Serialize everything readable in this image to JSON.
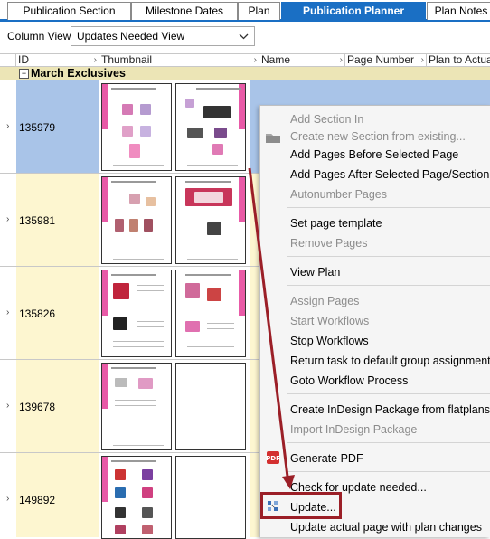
{
  "tabs": [
    {
      "label": "Publication Section",
      "active": false
    },
    {
      "label": "Milestone Dates",
      "active": false
    },
    {
      "label": "Plan",
      "active": false
    },
    {
      "label": "Publication Planner",
      "active": true
    },
    {
      "label": "Plan Notes",
      "active": false
    }
  ],
  "column_view": {
    "label": "Column View:",
    "value": "Updates Needed View"
  },
  "grid": {
    "headers": [
      "ID",
      "Thumbnail",
      "Name",
      "Page Number",
      "Plan to Actual"
    ],
    "group": {
      "toggle": "−",
      "title": "March Exclusives"
    },
    "rows": [
      {
        "id": "135979"
      },
      {
        "id": "135981"
      },
      {
        "id": "135826"
      },
      {
        "id": "139678"
      },
      {
        "id": "149892"
      }
    ]
  },
  "context_menu": {
    "items": [
      {
        "label": "Add Section In",
        "disabled": true
      },
      {
        "label": "Create new Section from existing...",
        "disabled": true,
        "icon": "folder-icon"
      },
      {
        "label": "Add Pages Before Selected Page",
        "disabled": false
      },
      {
        "label": "Add Pages After Selected Page/Section",
        "disabled": false
      },
      {
        "label": "Autonumber Pages",
        "disabled": true
      },
      {
        "label": "Set page template",
        "disabled": false
      },
      {
        "label": "Remove Pages",
        "disabled": true
      },
      {
        "label": "View Plan",
        "disabled": false
      },
      {
        "label": "Assign Pages",
        "disabled": true
      },
      {
        "label": "Start Workflows",
        "disabled": true
      },
      {
        "label": "Stop Workflows",
        "disabled": false
      },
      {
        "label": "Return task to default group assignment",
        "disabled": false
      },
      {
        "label": "Goto Workflow Process",
        "disabled": false
      },
      {
        "label": "Create InDesign Package from flatplans",
        "disabled": false
      },
      {
        "label": "Import InDesign Package",
        "disabled": true
      },
      {
        "label": "Generate PDF",
        "disabled": false,
        "icon": "pdf-icon"
      },
      {
        "label": "Check for update needed...",
        "disabled": false
      },
      {
        "label": "Update...",
        "disabled": false,
        "icon": "update-icon",
        "highlighted": true
      },
      {
        "label": "Update actual page with plan changes",
        "disabled": false
      }
    ]
  },
  "colors": {
    "accent": "#1a6fc4",
    "selected_row": "#a9c4e8",
    "row_yellow": "#fdf6d0",
    "group_row": "#ece5b6",
    "annotation": "#9b1f27",
    "thumb_band": "#e85aa7"
  }
}
